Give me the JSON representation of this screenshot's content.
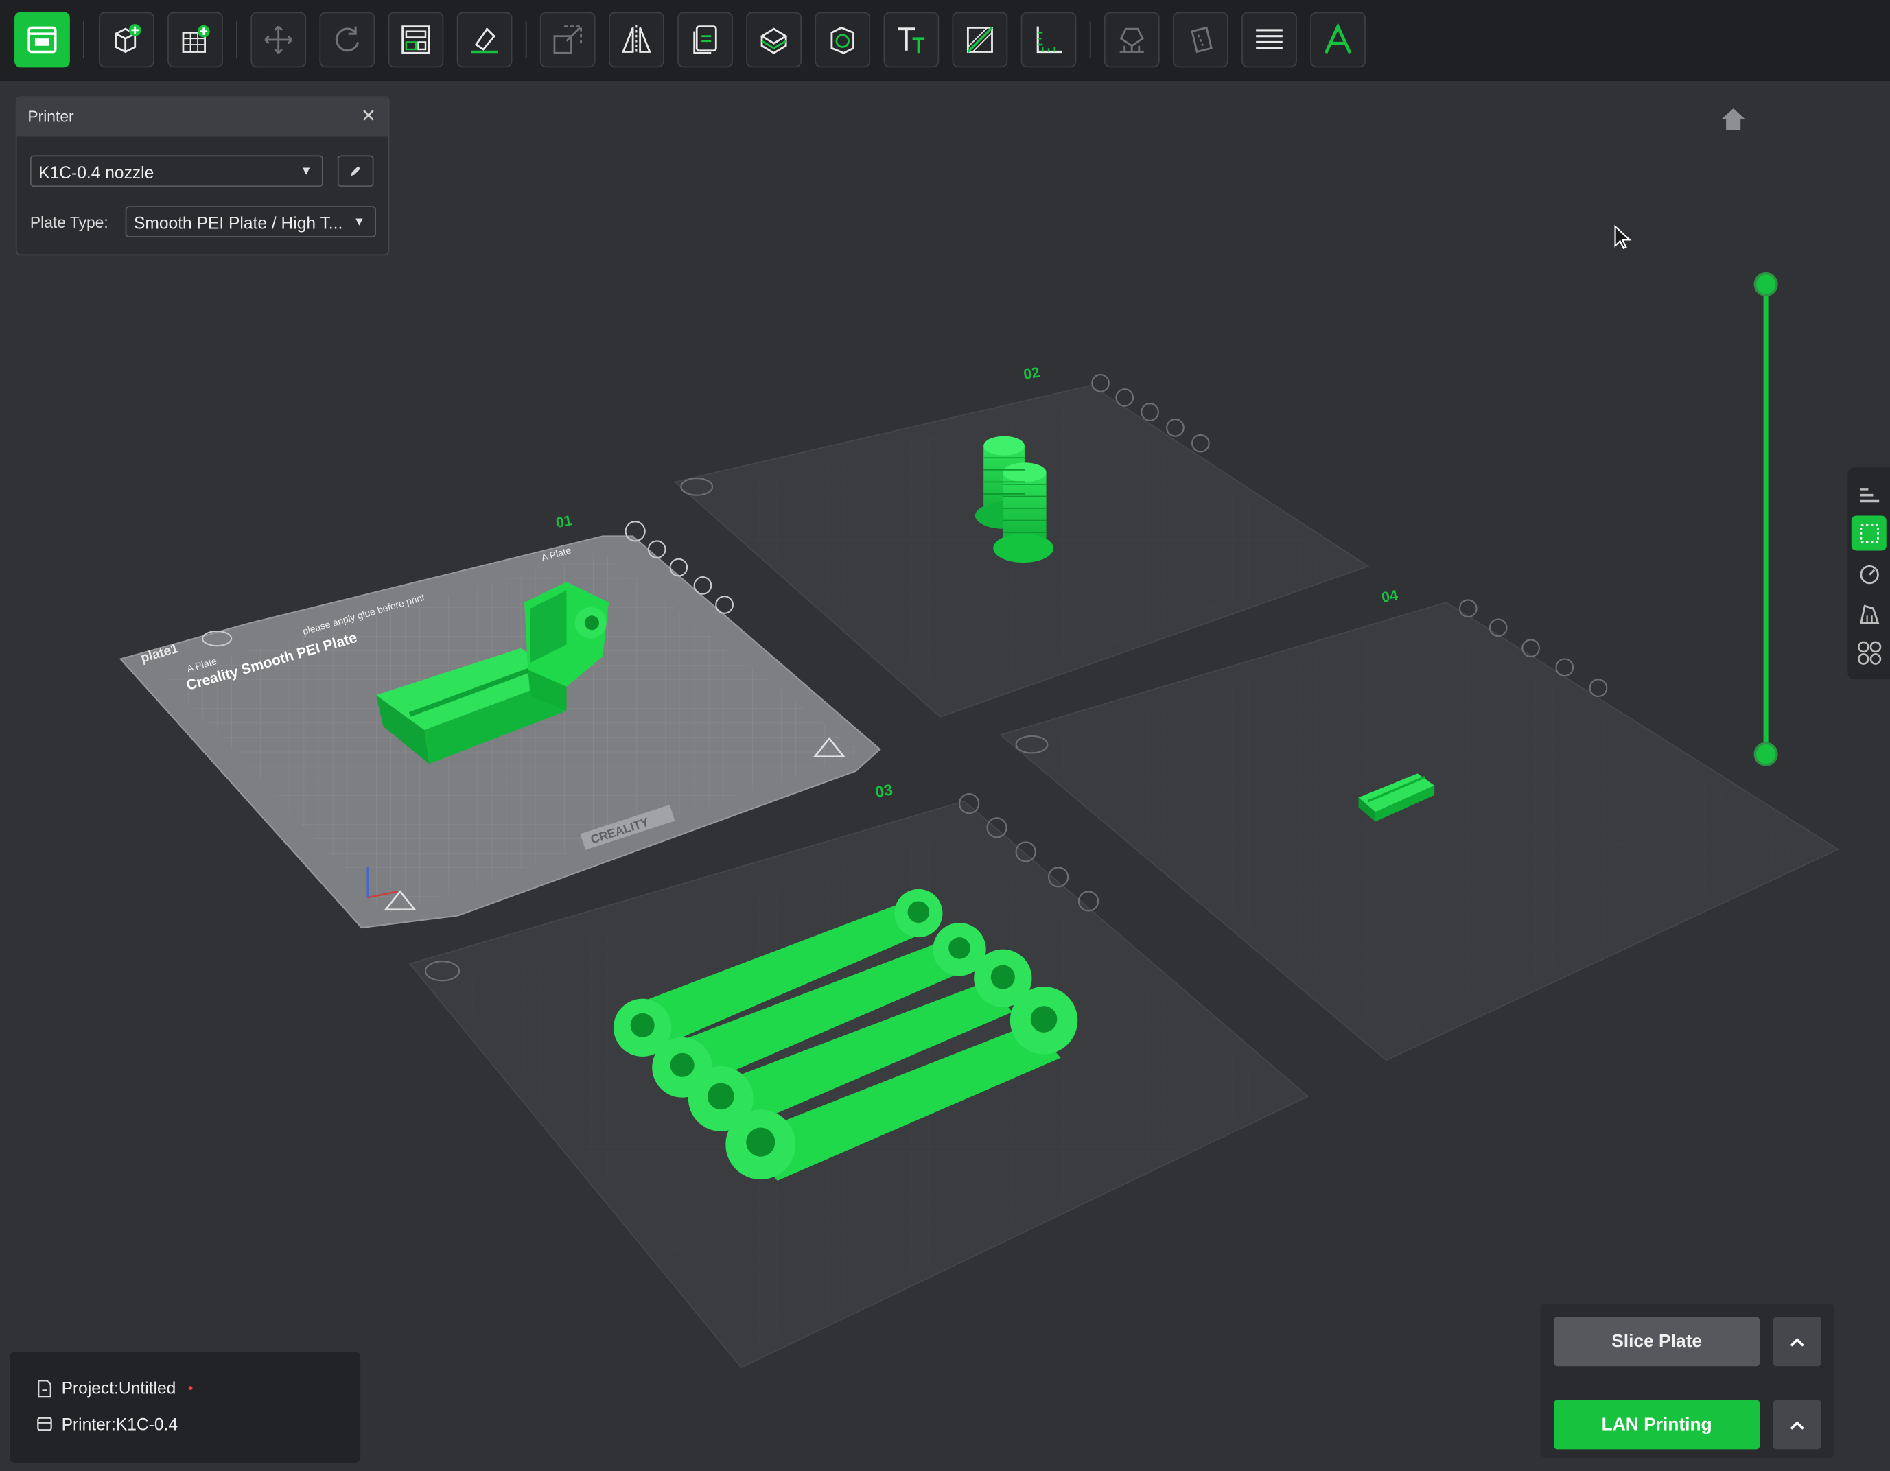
{
  "toolbar": {
    "items": [
      {
        "name": "prepare-view-icon",
        "active": true
      },
      {
        "name": "add-object-icon"
      },
      {
        "name": "add-plate-icon"
      },
      {
        "name": "move-icon"
      },
      {
        "name": "rotate-icon"
      },
      {
        "name": "arrange-icon"
      },
      {
        "name": "lay-on-face-icon"
      },
      {
        "name": "scale-icon"
      },
      {
        "name": "mirror-icon"
      },
      {
        "name": "copy-plate-icon"
      },
      {
        "name": "cut-icon"
      },
      {
        "name": "hollow-icon"
      },
      {
        "name": "text-icon"
      },
      {
        "name": "split-icon"
      },
      {
        "name": "measure-icon"
      },
      {
        "name": "support-paint-icon"
      },
      {
        "name": "seam-paint-icon"
      },
      {
        "name": "layers-icon"
      },
      {
        "name": "font-icon"
      }
    ]
  },
  "printer_panel": {
    "title": "Printer",
    "printer_value": "K1C-0.4 nozzle",
    "plate_type_label": "Plate Type:",
    "plate_type_value": "Smooth PEI Plate / High T..."
  },
  "plates": [
    {
      "number": "01",
      "name": "plate1",
      "bed_label": "Creality Smooth PEI Plate",
      "side_label": "A Plate",
      "warning_text": "please apply glue before print",
      "brand": "CREALITY"
    },
    {
      "number": "02"
    },
    {
      "number": "03"
    },
    {
      "number": "04"
    }
  ],
  "status": {
    "project_label": "Project:Untitled",
    "printer_label": "Printer:K1C-0.4"
  },
  "actions": {
    "slice_label": "Slice Plate",
    "lan_label": "LAN Printing"
  },
  "colors": {
    "accent": "#17c23f",
    "background": "#313236",
    "toolbar": "#1f2023",
    "model_green": "#1fd94a"
  }
}
